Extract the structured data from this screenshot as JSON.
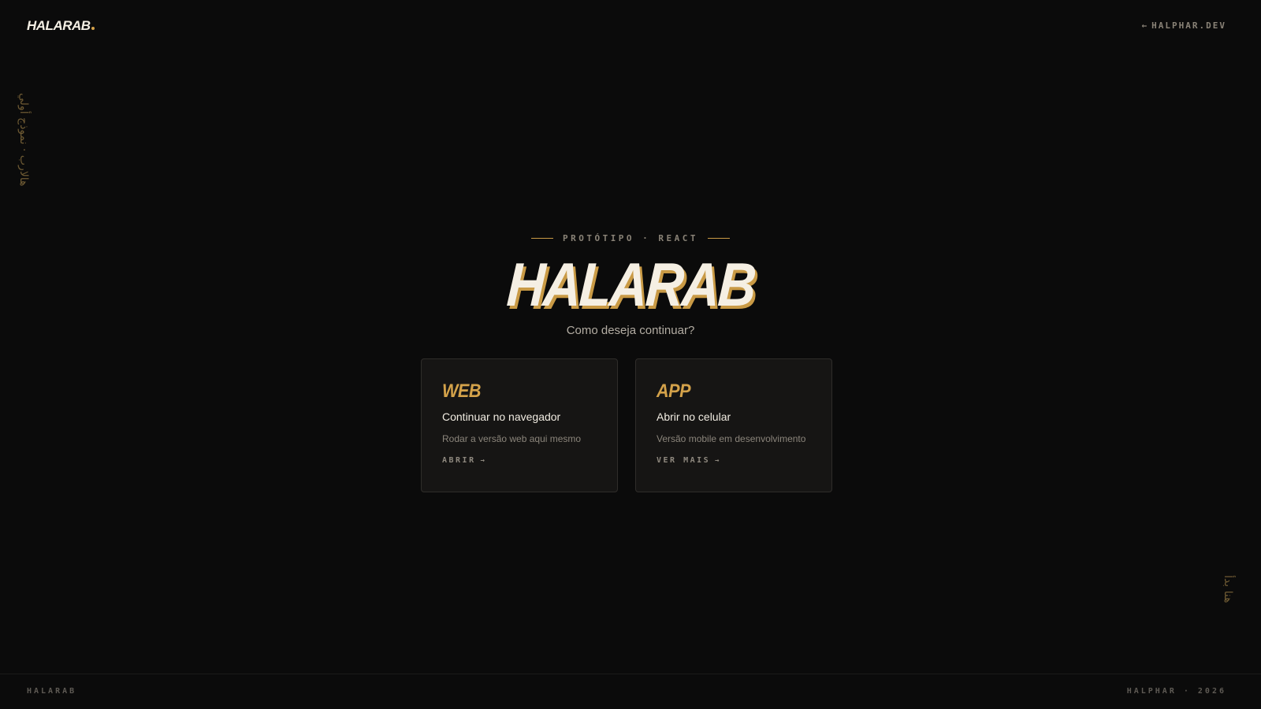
{
  "header": {
    "brand": "HALARAB",
    "link_label": "HALPHAR.DEV",
    "link_arrow": "←"
  },
  "side": {
    "left_vertical": "هالارب · نموذج أولي",
    "right_vertical": "هنا بدأ"
  },
  "hero": {
    "eyebrow": "PROTÓTIPO · REACT",
    "title": "HALARAB",
    "subtitle": "Como deseja continuar?"
  },
  "cards": [
    {
      "tag": "WEB",
      "title": "Continuar no navegador",
      "description": "Rodar a versão web aqui mesmo",
      "action": "ABRIR",
      "arrow": "→"
    },
    {
      "tag": "APP",
      "title": "Abrir no celular",
      "description": "Versão mobile em desenvolvimento",
      "action": "VER MAIS",
      "arrow": "→"
    }
  ],
  "footer": {
    "left": "HALARAB",
    "right": "HALPHAR · 2026"
  },
  "colors": {
    "background": "#0b0b0b",
    "accent": "#d4a24a",
    "card_bg": "#161514",
    "text": "#f2ede3"
  }
}
